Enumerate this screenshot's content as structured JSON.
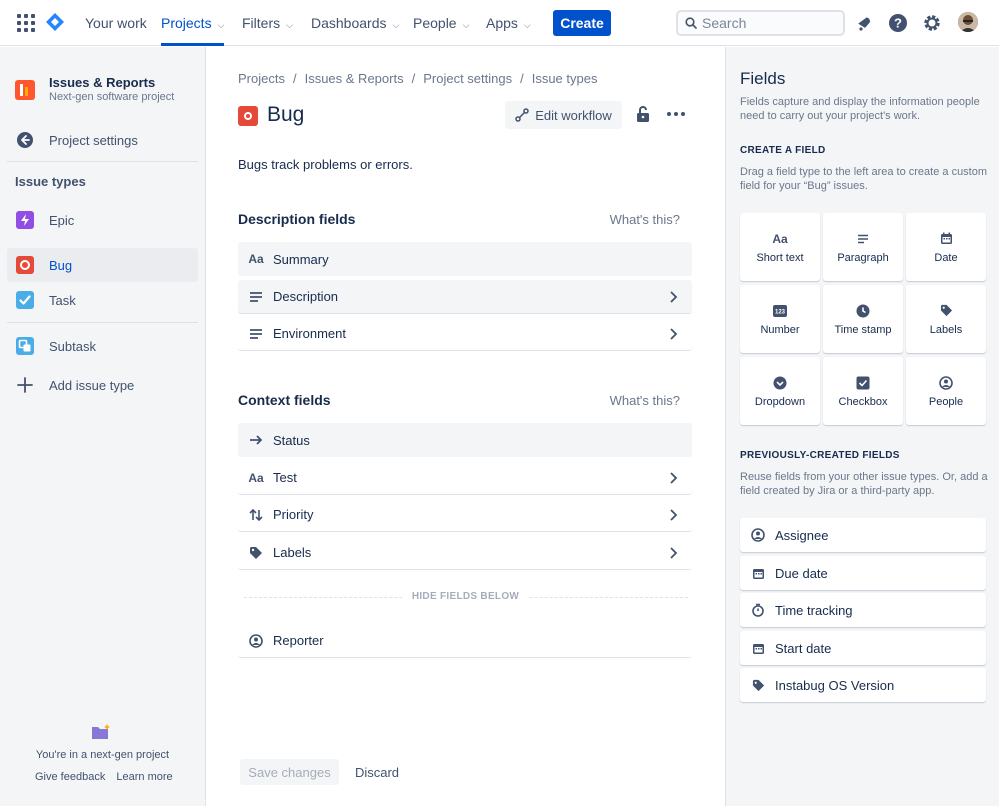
{
  "topnav": {
    "items": [
      {
        "label": "Your work"
      },
      {
        "label": "Projects"
      },
      {
        "label": "Filters"
      },
      {
        "label": "Dashboards"
      },
      {
        "label": "People"
      },
      {
        "label": "Apps"
      }
    ],
    "create_label": "Create",
    "search_placeholder": "Search"
  },
  "sidebar": {
    "project_name": "Issues & Reports",
    "project_sub": "Next-gen software project",
    "project_settings": "Project settings",
    "issue_types_heading": "Issue types",
    "items": [
      {
        "label": "Epic",
        "icon": "epic-icon"
      },
      {
        "label": "Bug",
        "icon": "bug-icon"
      },
      {
        "label": "Task",
        "icon": "task-icon"
      },
      {
        "label": "Subtask",
        "icon": "subtask-icon"
      }
    ],
    "add_issue_type": "Add issue type",
    "nextgen_text": "You're in a next-gen project",
    "give_feedback": "Give feedback",
    "learn_more": "Learn more"
  },
  "main": {
    "breadcrumb": [
      "Projects",
      "Issues & Reports",
      "Project settings",
      "Issue types"
    ],
    "title": "Bug",
    "edit_workflow": "Edit workflow",
    "description": "Bugs track problems or errors.",
    "description_fields_title": "Description fields",
    "context_fields_title": "Context fields",
    "whats_this": "What's this?",
    "description_fields": [
      {
        "label": "Summary",
        "icon": "short-text-icon"
      },
      {
        "label": "Description",
        "icon": "paragraph-icon"
      },
      {
        "label": "Environment",
        "icon": "paragraph-icon"
      }
    ],
    "context_fields": [
      {
        "label": "Status",
        "icon": "arrow-right-icon"
      },
      {
        "label": "Test",
        "icon": "short-text-icon"
      },
      {
        "label": "Priority",
        "icon": "priority-icon"
      },
      {
        "label": "Labels",
        "icon": "label-icon"
      }
    ],
    "hide_fields_below": "HIDE FIELDS BELOW",
    "hidden_fields": [
      {
        "label": "Reporter",
        "icon": "person-icon"
      }
    ],
    "save_changes": "Save changes",
    "discard": "Discard"
  },
  "panel": {
    "title": "Fields",
    "intro": "Fields capture and display the information people need to carry out your project's work.",
    "create_heading": "CREATE A FIELD",
    "create_text": "Drag a field type to the left area to create a custom field for your “Bug” issues.",
    "field_types": [
      {
        "label": "Short text",
        "icon": "short-text-icon"
      },
      {
        "label": "Paragraph",
        "icon": "paragraph-icon"
      },
      {
        "label": "Date",
        "icon": "calendar-icon"
      },
      {
        "label": "Number",
        "icon": "number-icon"
      },
      {
        "label": "Time stamp",
        "icon": "clock-icon"
      },
      {
        "label": "Labels",
        "icon": "label-icon"
      },
      {
        "label": "Dropdown",
        "icon": "dropdown-icon"
      },
      {
        "label": "Checkbox",
        "icon": "checkbox-icon"
      },
      {
        "label": "People",
        "icon": "person-icon"
      }
    ],
    "prev_heading": "PREVIOUSLY-CREATED FIELDS",
    "prev_text": "Reuse fields from your other issue types. Or, add a field created by Jira or a third-party app.",
    "prev_fields": [
      {
        "label": "Assignee",
        "icon": "person-icon"
      },
      {
        "label": "Due date",
        "icon": "calendar-icon"
      },
      {
        "label": "Time tracking",
        "icon": "stopwatch-icon"
      },
      {
        "label": "Start date",
        "icon": "calendar-icon"
      },
      {
        "label": "Instabug OS Version",
        "icon": "label-icon"
      }
    ]
  },
  "colors": {
    "brand_blue": "#0052CC",
    "bug_red": "#E5493A",
    "epic_purple": "#904EE2",
    "task_blue": "#4BADE8"
  }
}
